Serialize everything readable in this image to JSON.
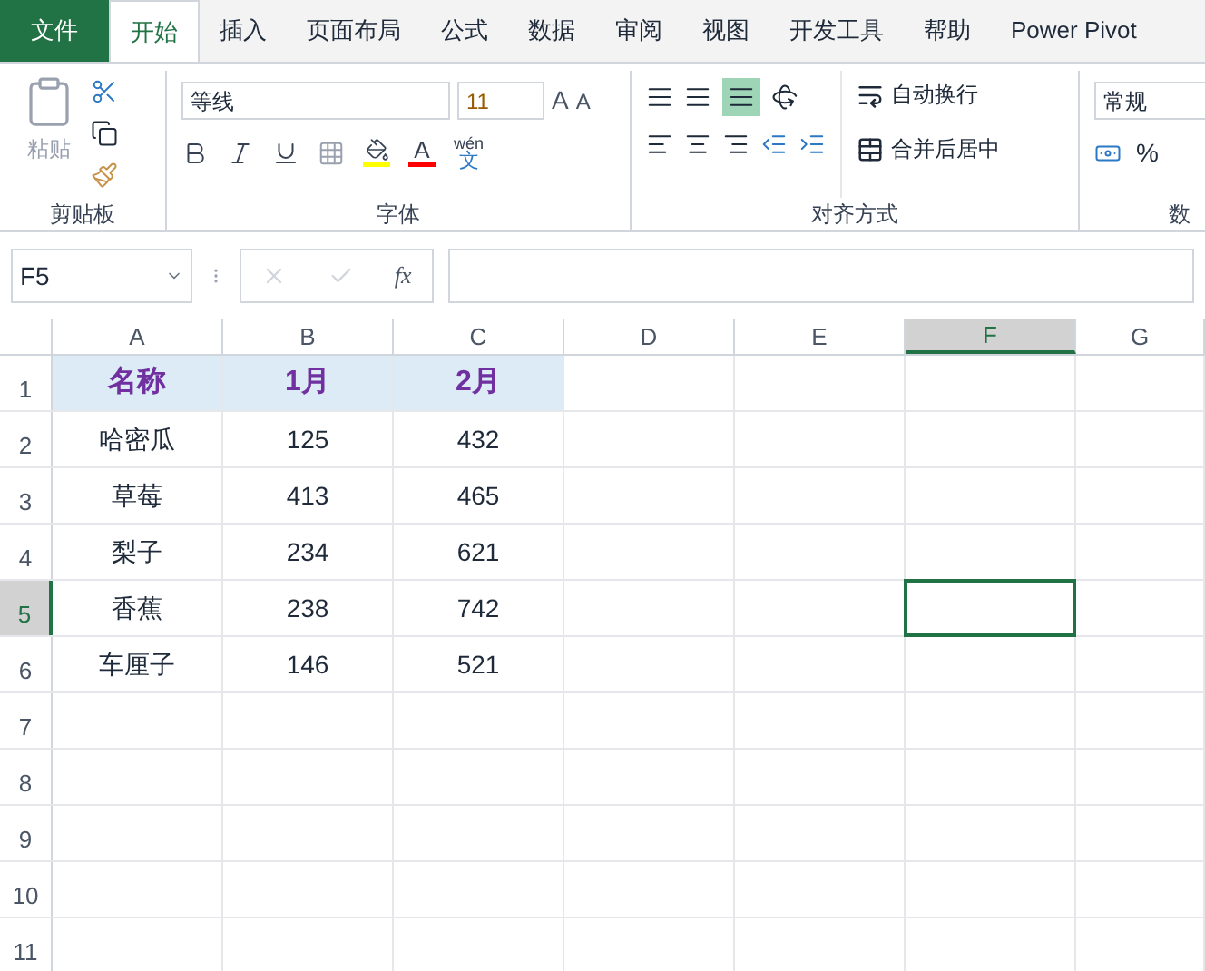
{
  "tabs": [
    {
      "label": "文件",
      "kind": "file",
      "selected": false
    },
    {
      "label": "开始",
      "kind": "tab",
      "selected": true
    },
    {
      "label": "插入",
      "kind": "tab",
      "selected": false
    },
    {
      "label": "页面布局",
      "kind": "tab",
      "selected": false
    },
    {
      "label": "公式",
      "kind": "tab",
      "selected": false
    },
    {
      "label": "数据",
      "kind": "tab",
      "selected": false
    },
    {
      "label": "审阅",
      "kind": "tab",
      "selected": false
    },
    {
      "label": "视图",
      "kind": "tab",
      "selected": false
    },
    {
      "label": "开发工具",
      "kind": "tab",
      "selected": false
    },
    {
      "label": "帮助",
      "kind": "tab",
      "selected": false
    },
    {
      "label": "Power Pivot",
      "kind": "tab",
      "selected": false
    }
  ],
  "ribbon": {
    "clipboard": {
      "paste": "粘贴",
      "label": "剪贴板"
    },
    "font": {
      "name": "等线",
      "size": "11",
      "grow": "A",
      "shrink": "A",
      "color_letter": "A",
      "phonetic_top": "wén",
      "phonetic_bottom": "文",
      "label": "字体"
    },
    "alignment": {
      "wrap": "自动换行",
      "merge": "合并后居中",
      "label": "对齐方式"
    },
    "number": {
      "format": "常规",
      "percent": "%",
      "label": "数"
    }
  },
  "formula_bar": {
    "name_box": "F5",
    "fx": "fx"
  },
  "sheet": {
    "columns": [
      {
        "label": "A",
        "selected": false
      },
      {
        "label": "B",
        "selected": false
      },
      {
        "label": "C",
        "selected": false
      },
      {
        "label": "D",
        "selected": false
      },
      {
        "label": "E",
        "selected": false
      },
      {
        "label": "F",
        "selected": true
      },
      {
        "label": "G",
        "selected": false
      }
    ],
    "rows": [
      {
        "number": "1",
        "selected": false,
        "kind": "header",
        "cells": [
          "名称",
          "1月",
          "2月"
        ]
      },
      {
        "number": "2",
        "selected": false,
        "kind": "data",
        "cells": [
          "哈密瓜",
          "125",
          "432"
        ]
      },
      {
        "number": "3",
        "selected": false,
        "kind": "data",
        "cells": [
          "草莓",
          "413",
          "465"
        ]
      },
      {
        "number": "4",
        "selected": false,
        "kind": "data",
        "cells": [
          "梨子",
          "234",
          "621"
        ]
      },
      {
        "number": "5",
        "selected": true,
        "kind": "data",
        "cells": [
          "香蕉",
          "238",
          "742"
        ]
      },
      {
        "number": "6",
        "selected": false,
        "kind": "data",
        "cells": [
          "车厘子",
          "146",
          "521"
        ]
      },
      {
        "number": "7",
        "selected": false,
        "kind": "data",
        "cells": []
      },
      {
        "number": "8",
        "selected": false,
        "kind": "data",
        "cells": []
      },
      {
        "number": "9",
        "selected": false,
        "kind": "data",
        "cells": []
      },
      {
        "number": "10",
        "selected": false,
        "kind": "data",
        "cells": []
      },
      {
        "number": "11",
        "selected": false,
        "kind": "data",
        "cells": []
      }
    ]
  }
}
